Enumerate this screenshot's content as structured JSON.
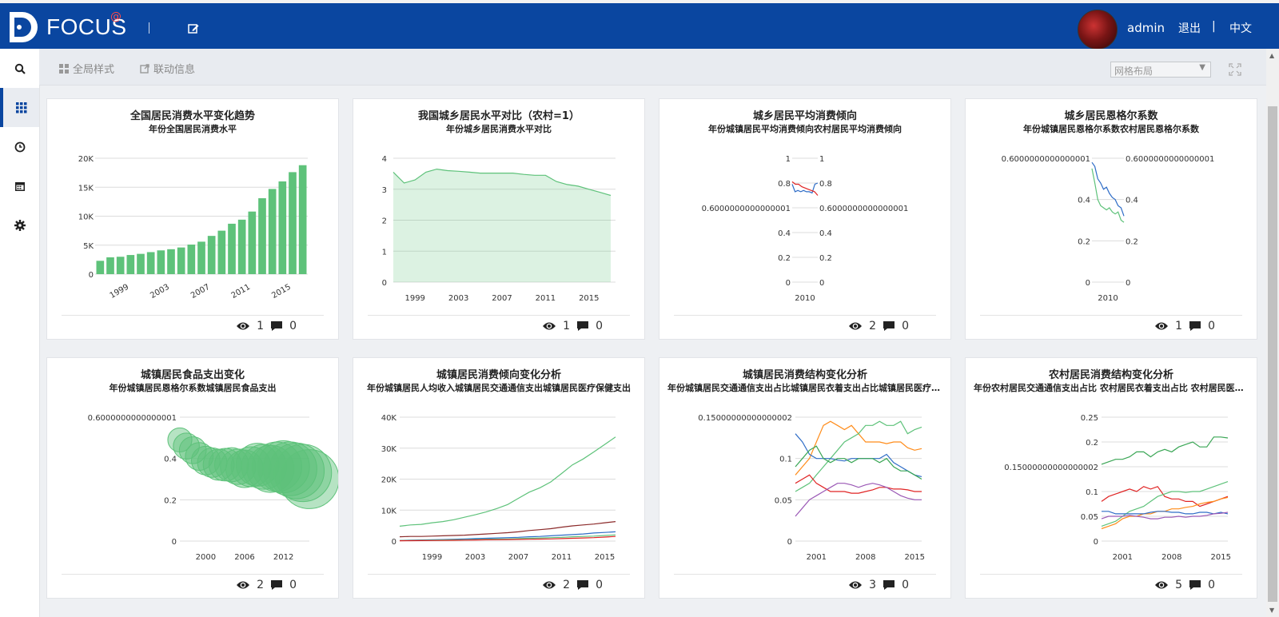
{
  "header": {
    "logo_text": "FOCUS",
    "logo_sup": "@",
    "username": "admin",
    "logout": "退出",
    "separator": "|",
    "language": "中文"
  },
  "toolbar": {
    "global_style": "全局样式",
    "linkage_info": "联动信息",
    "layout_select": "网格布局"
  },
  "cards": [
    {
      "title": "全国居民消费水平变化趋势",
      "subtitle": "年份全国居民消费水平",
      "views": "1",
      "comments": "0",
      "chart_data": {
        "type": "bar",
        "categories": [
          "1997",
          "1998",
          "1999",
          "2000",
          "2001",
          "2002",
          "2003",
          "2004",
          "2005",
          "2006",
          "2007",
          "2008",
          "2009",
          "2010",
          "2011",
          "2012",
          "2013",
          "2014",
          "2015",
          "2016",
          "2017"
        ],
        "values": [
          2300,
          2900,
          3000,
          3300,
          3500,
          3800,
          4100,
          4300,
          4600,
          5100,
          5600,
          6600,
          7500,
          8700,
          9400,
          10800,
          13100,
          14700,
          16000,
          17600,
          18800
        ],
        "y_ticks": [
          0,
          5000,
          10000,
          15000,
          20000
        ],
        "y_tick_labels": [
          "0",
          "5K",
          "10K",
          "15K",
          "20K"
        ],
        "x_tick_labels": [
          "1999",
          "2003",
          "2007",
          "2011",
          "2015"
        ],
        "ylim": [
          0,
          20000
        ]
      }
    },
    {
      "title": "我国城乡居民水平对比（农村=1）",
      "subtitle": "年份城乡居民消费水平对比",
      "views": "1",
      "comments": "0",
      "chart_data": {
        "type": "area",
        "x": [
          1997,
          1998,
          1999,
          2000,
          2001,
          2002,
          2003,
          2004,
          2005,
          2006,
          2007,
          2008,
          2009,
          2010,
          2011,
          2012,
          2013,
          2014,
          2015,
          2016,
          2017
        ],
        "values": [
          3.55,
          3.2,
          3.3,
          3.55,
          3.65,
          3.6,
          3.58,
          3.55,
          3.52,
          3.52,
          3.52,
          3.52,
          3.48,
          3.45,
          3.45,
          3.25,
          3.15,
          3.1,
          3.0,
          2.9,
          2.8
        ],
        "y_ticks": [
          0,
          1,
          2,
          3,
          4
        ],
        "x_tick_labels": [
          "1999",
          "2003",
          "2007",
          "2011",
          "2015"
        ],
        "ylim": [
          0,
          4
        ]
      }
    },
    {
      "title": "城乡居民平均消费倾向",
      "subtitle": "年份城镇居民平均消费倾向农村居民平均消费倾向",
      "views": "2",
      "comments": "0",
      "chart_data": {
        "type": "line",
        "y_tick_labels": [
          "0",
          "0.2",
          "0.4",
          "0.6000000000000001",
          "0.8",
          "1"
        ],
        "x_tick_labels": [
          "2010"
        ],
        "series": [
          {
            "values": [
              0.79,
              0.73,
              0.74,
              0.73,
              0.74,
              0.73,
              0.73,
              0.72,
              0.79,
              0.8
            ],
            "color": "#2f6dc7"
          },
          {
            "values": [
              0.81,
              0.79,
              0.79,
              0.77,
              0.76,
              0.75,
              0.74,
              0.73,
              0.7
            ],
            "color": "#e02424"
          }
        ],
        "ylim": [
          0,
          1
        ]
      }
    },
    {
      "title": "城乡居民恩格尔系数",
      "subtitle": "年份城镇居民恩格尔系数农村居民恩格尔系数",
      "views": "1",
      "comments": "0",
      "chart_data": {
        "type": "line",
        "y_tick_labels": [
          "0",
          "0.2",
          "0.4",
          "0.6000000000000001"
        ],
        "x_tick_labels": [
          "2010"
        ],
        "series": [
          {
            "values": [
              0.58,
              0.56,
              0.5,
              0.48,
              0.45,
              0.46,
              0.43,
              0.41,
              0.4,
              0.37,
              0.36,
              0.32
            ],
            "color": "#2f6dc7"
          },
          {
            "values": [
              0.55,
              0.48,
              0.4,
              0.37,
              0.36,
              0.35,
              0.36,
              0.34,
              0.33,
              0.34,
              0.3,
              0.29
            ],
            "color": "#5ec27a"
          }
        ],
        "ylim": [
          0,
          0.6
        ]
      }
    },
    {
      "title": "城镇居民食品支出变化",
      "subtitle": "年份城镇居民恩格尔系数城镇居民食品支出",
      "views": "2",
      "comments": "0",
      "chart_data": {
        "type": "scatter",
        "x": [
          1996,
          1997,
          1998,
          1999,
          2000,
          2001,
          2002,
          2003,
          2004,
          2005,
          2006,
          2007,
          2008,
          2009,
          2010,
          2011,
          2012,
          2013,
          2014,
          2015,
          2016
        ],
        "values": [
          0.49,
          0.46,
          0.44,
          0.41,
          0.39,
          0.38,
          0.37,
          0.37,
          0.37,
          0.36,
          0.35,
          0.36,
          0.37,
          0.36,
          0.35,
          0.36,
          0.36,
          0.35,
          0.34,
          0.33,
          0.3
        ],
        "sizes": [
          1200,
          1400,
          1500,
          1600,
          1700,
          1800,
          2000,
          2200,
          2400,
          2600,
          2900,
          3300,
          3800,
          4200,
          4600,
          5100,
          5600,
          6000,
          6400,
          6800,
          7200
        ],
        "y_tick_labels": [
          "0",
          "0.2",
          "0.4",
          "0.6000000000000001"
        ],
        "x_tick_labels": [
          "2000",
          "2006",
          "2012"
        ],
        "ylim": [
          0,
          0.6
        ]
      }
    },
    {
      "title": "城镇居民消费倾向变化分析",
      "subtitle": "年份城镇居民人均收入城镇居民交通通信支出城镇居民医疗保健支出",
      "views": "2",
      "comments": "0",
      "chart_data": {
        "type": "line",
        "x": [
          1996,
          1997,
          1998,
          1999,
          2000,
          2001,
          2002,
          2003,
          2004,
          2005,
          2006,
          2007,
          2008,
          2009,
          2010,
          2011,
          2012,
          2013,
          2014,
          2015,
          2016
        ],
        "y_tick_labels": [
          "0",
          "10K",
          "20K",
          "30K",
          "40K"
        ],
        "x_tick_labels": [
          "1999",
          "2003",
          "2007",
          "2011",
          "2015"
        ],
        "series": [
          {
            "values": [
              4800,
              5200,
              5400,
              5900,
              6300,
              6900,
              7700,
              8500,
              9400,
              10500,
              11800,
              13800,
              15800,
              17200,
              19100,
              21800,
              24600,
              26500,
              28800,
              31200,
              33600
            ],
            "color": "#5ec27a"
          },
          {
            "values": [
              1400,
              1500,
              1500,
              1600,
              1700,
              1800,
              1900,
              2100,
              2300,
              2500,
              2700,
              3000,
              3400,
              3700,
              4000,
              4500,
              4900,
              5200,
              5500,
              5900,
              6300
            ],
            "color": "#8b2a2a"
          },
          {
            "values": [
              200,
              300,
              350,
              400,
              500,
              600,
              700,
              800,
              900,
              1000,
              1100,
              1200,
              1400,
              1500,
              1700,
              1900,
              2100,
              2300,
              2600,
              2800,
              3000
            ],
            "color": "#2f6dc7"
          },
          {
            "values": [
              150,
              200,
              250,
              300,
              350,
              400,
              450,
              500,
              600,
              650,
              700,
              800,
              900,
              1000,
              1100,
              1200,
              1400,
              1500,
              1600,
              1800,
              2000
            ],
            "color": "#5ec27a"
          },
          {
            "values": [
              100,
              120,
              150,
              180,
              200,
              250,
              300,
              350,
              400,
              450,
              500,
              550,
              600,
              650,
              700,
              800,
              900,
              1000,
              1100,
              1300,
              1500
            ],
            "color": "#e02424"
          }
        ],
        "ylim": [
          0,
          40000
        ]
      }
    },
    {
      "title": "城镇居民消费结构变化分析",
      "subtitle": "年份城镇居民交通通信支出占比城镇居民衣着支出占比城镇居民医疗保健支出占比",
      "views": "3",
      "comments": "0",
      "chart_data": {
        "type": "line",
        "x": [
          1998,
          1999,
          2000,
          2001,
          2002,
          2003,
          2004,
          2005,
          2006,
          2007,
          2008,
          2009,
          2010,
          2011,
          2012,
          2013,
          2014,
          2015,
          2016
        ],
        "y_tick_labels": [
          "0",
          "0.05",
          "0.1",
          "0.15000000000000002"
        ],
        "x_tick_labels": [
          "2001",
          "2008",
          "2015"
        ],
        "series": [
          {
            "values": [
              0.08,
              0.09,
              0.1,
              0.12,
              0.14,
              0.145,
              0.14,
              0.135,
              0.14,
              0.13,
              0.12,
              0.12,
              0.12,
              0.118,
              0.12,
              0.12,
              0.113,
              0.11,
              0.112
            ],
            "color": "#ff8c1a"
          },
          {
            "values": [
              0.06,
              0.065,
              0.07,
              0.08,
              0.09,
              0.1,
              0.11,
              0.12,
              0.125,
              0.13,
              0.14,
              0.14,
              0.145,
              0.14,
              0.14,
              0.145,
              0.13,
              0.135,
              0.138
            ],
            "color": "#5ec27a"
          },
          {
            "values": [
              0.13,
              0.12,
              0.105,
              0.1,
              0.1,
              0.1,
              0.098,
              0.097,
              0.1,
              0.1,
              0.1,
              0.1,
              0.1,
              0.105,
              0.095,
              0.09,
              0.085,
              0.08,
              0.078
            ],
            "color": "#2f6dc7"
          },
          {
            "values": [
              0.09,
              0.1,
              0.11,
              0.115,
              0.1,
              0.095,
              0.1,
              0.1,
              0.095,
              0.1,
              0.1,
              0.1,
              0.095,
              0.1,
              0.09,
              0.085,
              0.085,
              0.08,
              0.075
            ],
            "color": "#3aa655"
          },
          {
            "values": [
              0.07,
              0.075,
              0.08,
              0.07,
              0.065,
              0.06,
              0.06,
              0.06,
              0.058,
              0.058,
              0.06,
              0.062,
              0.065,
              0.065,
              0.063,
              0.063,
              0.062,
              0.06,
              0.06
            ],
            "color": "#e02424"
          },
          {
            "values": [
              0.03,
              0.04,
              0.05,
              0.055,
              0.06,
              0.065,
              0.07,
              0.07,
              0.068,
              0.065,
              0.068,
              0.07,
              0.068,
              0.065,
              0.06,
              0.055,
              0.052,
              0.05,
              0.05
            ],
            "color": "#9b59b6"
          }
        ],
        "ylim": [
          0,
          0.15
        ]
      }
    },
    {
      "title": "农村居民消费结构变化分析",
      "subtitle": "年份农村居民交通通信支出占比 农村居民衣着支出占比 农村居民医疗保健支出占比",
      "views": "5",
      "comments": "0",
      "chart_data": {
        "type": "line",
        "x": [
          1998,
          1999,
          2000,
          2001,
          2002,
          2003,
          2004,
          2005,
          2006,
          2007,
          2008,
          2009,
          2010,
          2011,
          2012,
          2013,
          2014,
          2015,
          2016
        ],
        "y_tick_labels": [
          "0",
          "0.05",
          "0.1",
          "0.15000000000000002",
          "0.2",
          "0.25"
        ],
        "x_tick_labels": [
          "2001",
          "2008",
          "2015"
        ],
        "series": [
          {
            "values": [
              0.155,
              0.16,
              0.165,
              0.165,
              0.17,
              0.18,
              0.18,
              0.17,
              0.18,
              0.185,
              0.18,
              0.19,
              0.195,
              0.2,
              0.19,
              0.19,
              0.21,
              0.21,
              0.208
            ],
            "color": "#3aa655"
          },
          {
            "values": [
              0.08,
              0.09,
              0.095,
              0.1,
              0.105,
              0.1,
              0.11,
              0.105,
              0.11,
              0.09,
              0.085,
              0.085,
              0.08,
              0.08,
              0.07,
              0.075,
              0.08,
              0.085,
              0.09
            ],
            "color": "#e02424"
          },
          {
            "values": [
              0.03,
              0.035,
              0.04,
              0.05,
              0.06,
              0.065,
              0.07,
              0.08,
              0.09,
              0.095,
              0.1,
              0.1,
              0.098,
              0.1,
              0.1,
              0.105,
              0.11,
              0.115,
              0.12
            ],
            "color": "#5ec27a"
          },
          {
            "values": [
              0.025,
              0.03,
              0.035,
              0.045,
              0.05,
              0.05,
              0.055,
              0.055,
              0.06,
              0.06,
              0.065,
              0.065,
              0.068,
              0.07,
              0.075,
              0.078,
              0.08,
              0.085,
              0.088
            ],
            "color": "#ff8c1a"
          },
          {
            "values": [
              0.06,
              0.06,
              0.055,
              0.055,
              0.055,
              0.055,
              0.055,
              0.058,
              0.06,
              0.06,
              0.058,
              0.058,
              0.055,
              0.055,
              0.058,
              0.058,
              0.055,
              0.058,
              0.055
            ],
            "color": "#2f6dc7"
          },
          {
            "values": [
              0.045,
              0.05,
              0.05,
              0.05,
              0.052,
              0.05,
              0.048,
              0.045,
              0.045,
              0.048,
              0.048,
              0.05,
              0.048,
              0.05,
              0.05,
              0.052,
              0.055,
              0.056,
              0.058
            ],
            "color": "#9b59b6"
          }
        ],
        "ylim": [
          0,
          0.25
        ]
      }
    }
  ]
}
